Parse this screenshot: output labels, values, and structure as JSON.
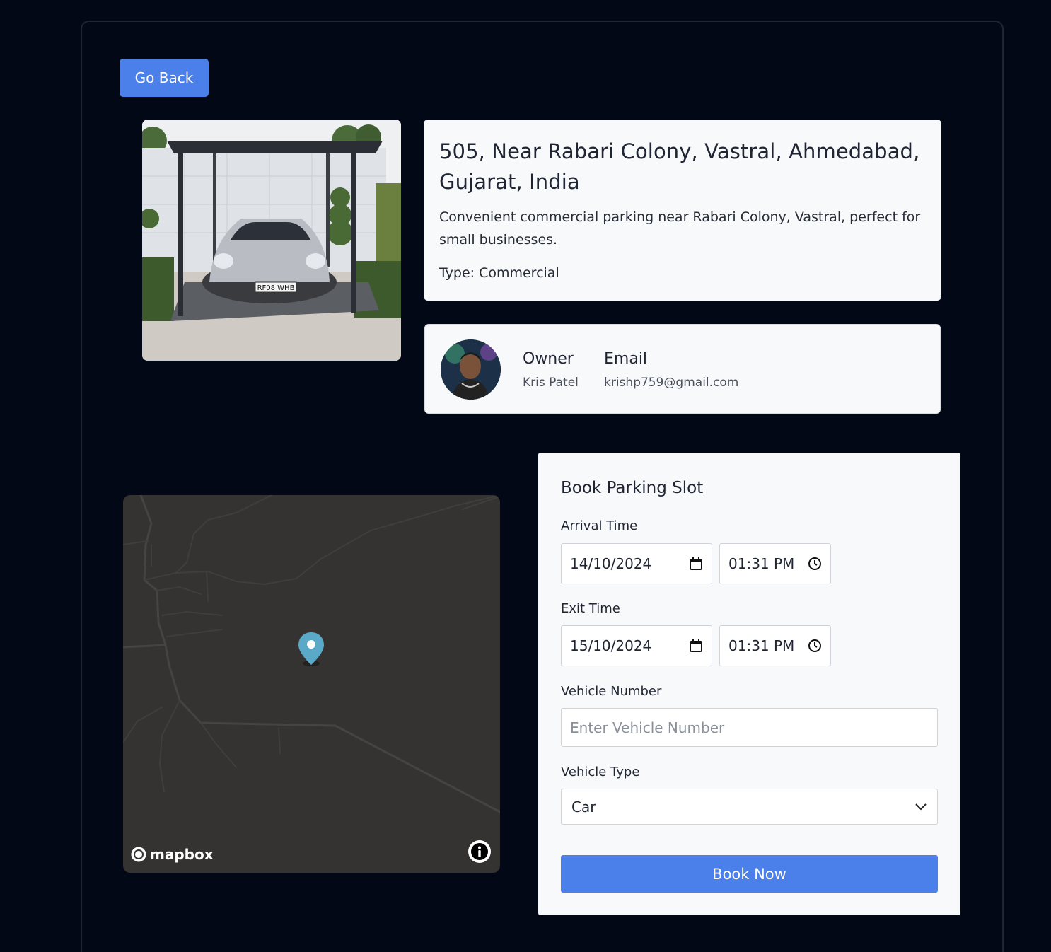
{
  "nav": {
    "go_back_label": "Go Back"
  },
  "listing": {
    "address": "505, Near Rabari Colony, Vastral, Ahmedabad, Gujarat, India",
    "description": "Convenient commercial parking near Rabari Colony, Vastral, perfect for small businesses.",
    "type_text": "Type: Commercial",
    "photo_plate_text": "RF08 WHB"
  },
  "owner": {
    "owner_label": "Owner",
    "owner_name": "Kris Patel",
    "email_label": "Email",
    "email": "krishp759@gmail.com"
  },
  "map": {
    "attribution": "mapbox",
    "marker_icon": "map-pin-icon",
    "info_icon": "info-icon"
  },
  "booking": {
    "title": "Book Parking Slot",
    "arrival_label": "Arrival Time",
    "arrival_date": "14/10/2024",
    "arrival_time": "01:31 PM",
    "exit_label": "Exit Time",
    "exit_date": "15/10/2024",
    "exit_time": "01:31 PM",
    "vehicle_number_label": "Vehicle Number",
    "vehicle_number_placeholder": "Enter Vehicle Number",
    "vehicle_type_label": "Vehicle Type",
    "vehicle_type_selected": "Car",
    "submit_label": "Book Now"
  },
  "colors": {
    "background": "#030816",
    "accent": "#4b7fea",
    "card": "#f8f9fb",
    "map_bg": "#343332",
    "marker": "#5aa9c9"
  }
}
